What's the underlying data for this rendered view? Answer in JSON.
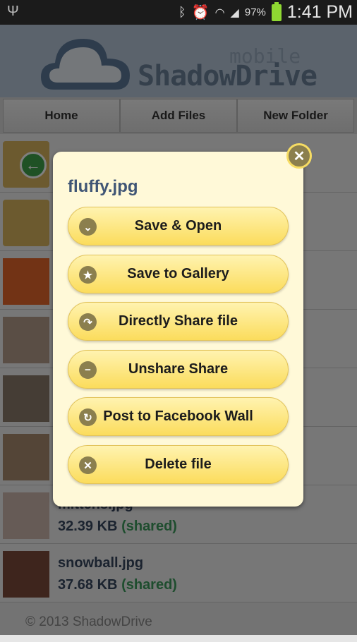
{
  "status_bar": {
    "battery": "97%",
    "time": "1:41 PM",
    "icons": [
      "usb-icon",
      "bluetooth-icon",
      "alarm-icon",
      "wifi-icon",
      "signal-icon",
      "battery-charging-icon"
    ]
  },
  "header": {
    "logo_main": "ShadowDrive",
    "logo_sub": "mobile"
  },
  "nav": {
    "home": "Home",
    "add_files": "Add Files",
    "new_folder": "New Folder"
  },
  "files": [
    {
      "name": "mittens.jpg",
      "size": "32.39 KB",
      "status": "(shared)"
    },
    {
      "name": "snowball.jpg",
      "size": "37.68 KB",
      "status": "(shared)"
    }
  ],
  "footer": "© 2013 ShadowDrive",
  "dialog": {
    "title": "fluffy.jpg",
    "actions": [
      {
        "label": "Save & Open",
        "icon": "chevron-down-icon"
      },
      {
        "label": "Save to Gallery",
        "icon": "star-icon"
      },
      {
        "label": "Directly Share file",
        "icon": "share-arrow-icon"
      },
      {
        "label": "Unshare Share",
        "icon": "minus-icon"
      },
      {
        "label": "Post to Facebook Wall",
        "icon": "refresh-icon"
      },
      {
        "label": "Delete file",
        "icon": "close-icon"
      }
    ]
  },
  "colors": {
    "dialog_bg": "#fff9d8",
    "button": "#fbdc5c",
    "shared": "#3c9a5c",
    "title": "#3f5575"
  }
}
